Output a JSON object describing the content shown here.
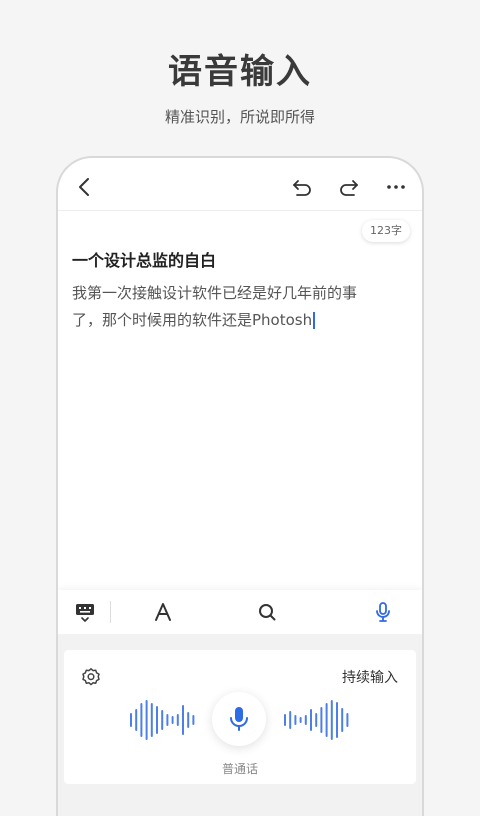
{
  "hero": {
    "title": "语音输入",
    "subtitle": "精准识别，所说即所得"
  },
  "topbar": {
    "icons": [
      "back-arrow-icon",
      "undo-icon",
      "redo-icon",
      "more-icon"
    ]
  },
  "document": {
    "word_count": "123字",
    "title": "一个设计总监的自白",
    "body_line1": "我第一次接触设计软件已经是好几年前的事",
    "body_line2": "了，那个时候用的软件还是Photosh"
  },
  "toolbar": {
    "icons": [
      "keyboard-icon",
      "font-icon",
      "search-icon",
      "microphone-icon"
    ],
    "active": "microphone-icon"
  },
  "voice": {
    "mode_label": "持续输入",
    "language": "普通话"
  },
  "colors": {
    "accent": "#2f6be4",
    "wave": "#4d7fe8"
  }
}
